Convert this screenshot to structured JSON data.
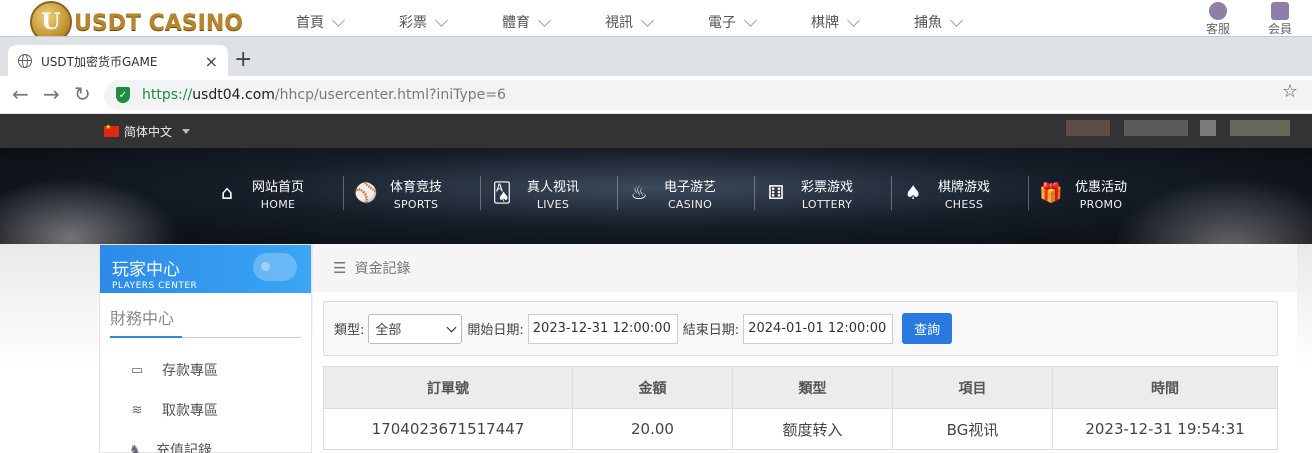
{
  "site": {
    "logo_text": "USDT CASINO",
    "logo_letter": "U",
    "menu": [
      "首頁",
      "彩票",
      "體育",
      "視訊",
      "電子",
      "棋牌",
      "捕魚"
    ],
    "side_service": "客服",
    "side_member": "会員"
  },
  "browser": {
    "tab_title": "USDT加密货币GAME",
    "tab_close": "×",
    "new_tab": "+",
    "url_scheme": "https://",
    "url_host": "usdt04.com",
    "url_path": "/hhcp/usercenter.html?iniType=6"
  },
  "langbar": {
    "language": "简体中文"
  },
  "main_nav": [
    {
      "zh": "网站首页",
      "en": "HOME",
      "icon": "⌂"
    },
    {
      "zh": "体育竞技",
      "en": "SPORTS",
      "icon": "⚾"
    },
    {
      "zh": "真人视讯",
      "en": "LIVES",
      "icon": "🂡"
    },
    {
      "zh": "电子游艺",
      "en": "CASINO",
      "icon": "♨"
    },
    {
      "zh": "彩票游戏",
      "en": "LOTTERY",
      "icon": "⚅"
    },
    {
      "zh": "棋牌游戏",
      "en": "CHESS",
      "icon": "♠"
    },
    {
      "zh": "优惠活动",
      "en": "PROMO",
      "icon": "🎁"
    }
  ],
  "sidebar": {
    "title_zh": "玩家中心",
    "title_en": "PLAYERS CENTER",
    "section": "財務中心",
    "items": [
      {
        "label": "存款專區",
        "icon": "▭"
      },
      {
        "label": "取款專區",
        "icon": "≋"
      },
      {
        "label": "充值記錄",
        "icon": "♞"
      }
    ]
  },
  "panel": {
    "title": "資金記錄",
    "filter": {
      "type_label": "類型:",
      "type_value": "全部",
      "start_label": "開始日期:",
      "start_value": "2023-12-31 12:00:00",
      "end_label": "結束日期:",
      "end_value": "2024-01-01 12:00:00",
      "query_button": "查詢"
    },
    "table": {
      "headers": [
        "訂單號",
        "金額",
        "類型",
        "項目",
        "時間"
      ],
      "rows": [
        [
          "1704023671517447",
          "20.00",
          "额度转入",
          "BG视讯",
          "2023-12-31 19:54:31"
        ]
      ]
    }
  },
  "colors": {
    "accent_blue": "#2979e0",
    "secure_green": "#1e8e3e",
    "logo_gold": "#b7852c",
    "dark_bar": "#333333"
  }
}
